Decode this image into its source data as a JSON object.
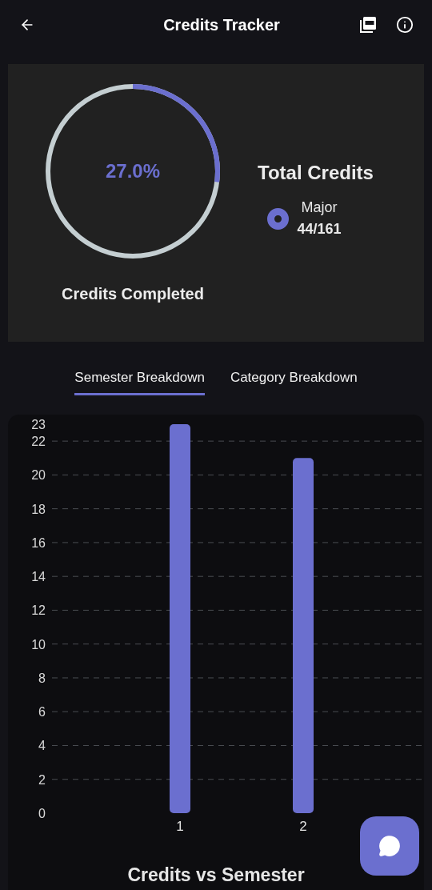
{
  "header": {
    "title": "Credits Tracker"
  },
  "summary": {
    "progress": {
      "percent": "27.0%",
      "caption": "Credits Completed"
    },
    "legend_title": "Total Credits",
    "legend": [
      {
        "label": "Major",
        "value": "44/161",
        "color": "#6b6fcf"
      }
    ]
  },
  "tabs": [
    {
      "label": "Semester Breakdown",
      "selected": true
    },
    {
      "label": "Category Breakdown",
      "selected": false
    }
  ],
  "chart": {
    "chart_data": {
      "type": "bar",
      "title": "Credits vs Semester",
      "categories": [
        "1",
        "2"
      ],
      "series": [
        {
          "color": "#6b6fcf",
          "values": [
            23,
            21
          ]
        }
      ],
      "grid": true,
      "ylim": [
        0,
        23
      ],
      "yticks": [
        0,
        2,
        4,
        6,
        8,
        10,
        12,
        14,
        16,
        18,
        20,
        22,
        23
      ]
    }
  }
}
